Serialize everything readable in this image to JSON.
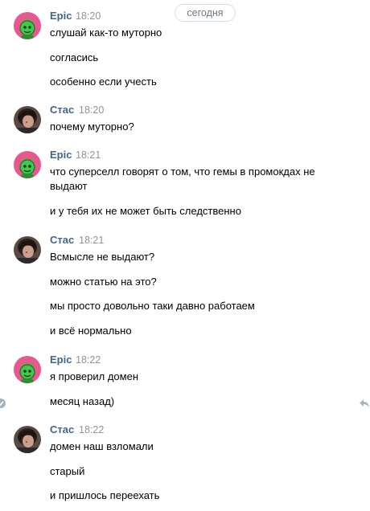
{
  "date_divider": "сегодня",
  "groups": [
    {
      "author": "Epic",
      "time": "18:20",
      "avatar": "brawl-character-avatar",
      "messages": [
        "слушай как-то муторно",
        "согласись",
        "особенно если учесть"
      ]
    },
    {
      "author": "Стас",
      "time": "18:20",
      "avatar": "user-photo-avatar",
      "messages": [
        "почему муторно?"
      ]
    },
    {
      "author": "Epic",
      "time": "18:21",
      "avatar": "brawl-character-avatar",
      "messages": [
        "что суперселл говорят о том, что гемы в промокдах не выдают",
        "и у тебя их не может быть следственно"
      ]
    },
    {
      "author": "Стас",
      "time": "18:21",
      "avatar": "user-photo-avatar",
      "messages": [
        "Всмысле не выдают?",
        "можно статью на это?",
        "мы просто довольно таки давно работаем",
        "и всё нормально"
      ]
    },
    {
      "author": "Epic",
      "time": "18:22",
      "avatar": "brawl-character-avatar",
      "messages": [
        "я проверил домен",
        "месяц назад)"
      ]
    },
    {
      "author": "Стас",
      "time": "18:22",
      "avatar": "user-photo-avatar",
      "messages": [
        "домен наш взломали",
        "старый",
        "и пришлось переехать"
      ]
    }
  ],
  "colors": {
    "author_name": "#42648b",
    "timestamp": "#939393",
    "pill_border": "#d7dce2",
    "epic_avatar_bg": "#e8578e"
  },
  "icons": {
    "left_edge": "select-check-icon",
    "right_edge": "reply-arrow-icon"
  }
}
